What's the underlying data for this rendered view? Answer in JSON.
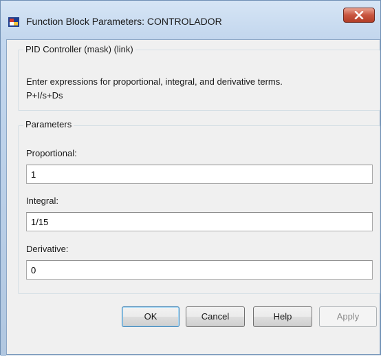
{
  "window": {
    "title": "Function Block Parameters: CONTROLADOR",
    "close_symbol": "X"
  },
  "block_group": {
    "legend": "PID Controller (mask) (link)",
    "description_line1": "Enter expressions for proportional, integral, and derivative terms.",
    "description_line2": "P+I/s+Ds"
  },
  "parameters": {
    "legend": "Parameters",
    "proportional": {
      "label": "Proportional:",
      "value": "1"
    },
    "integral": {
      "label": "Integral:",
      "value": "1/15"
    },
    "derivative": {
      "label": "Derivative:",
      "value": "0"
    }
  },
  "buttons": {
    "ok": "OK",
    "cancel": "Cancel",
    "help": "Help",
    "apply": "Apply"
  },
  "icons": {
    "app": "simulink-block-icon",
    "close": "close-icon"
  },
  "colors": {
    "titlebar": "#c3d7ee",
    "close_button": "#c8553f",
    "dialog_background": "#f0f0f0",
    "default_button_border": "#3c7fb1"
  }
}
